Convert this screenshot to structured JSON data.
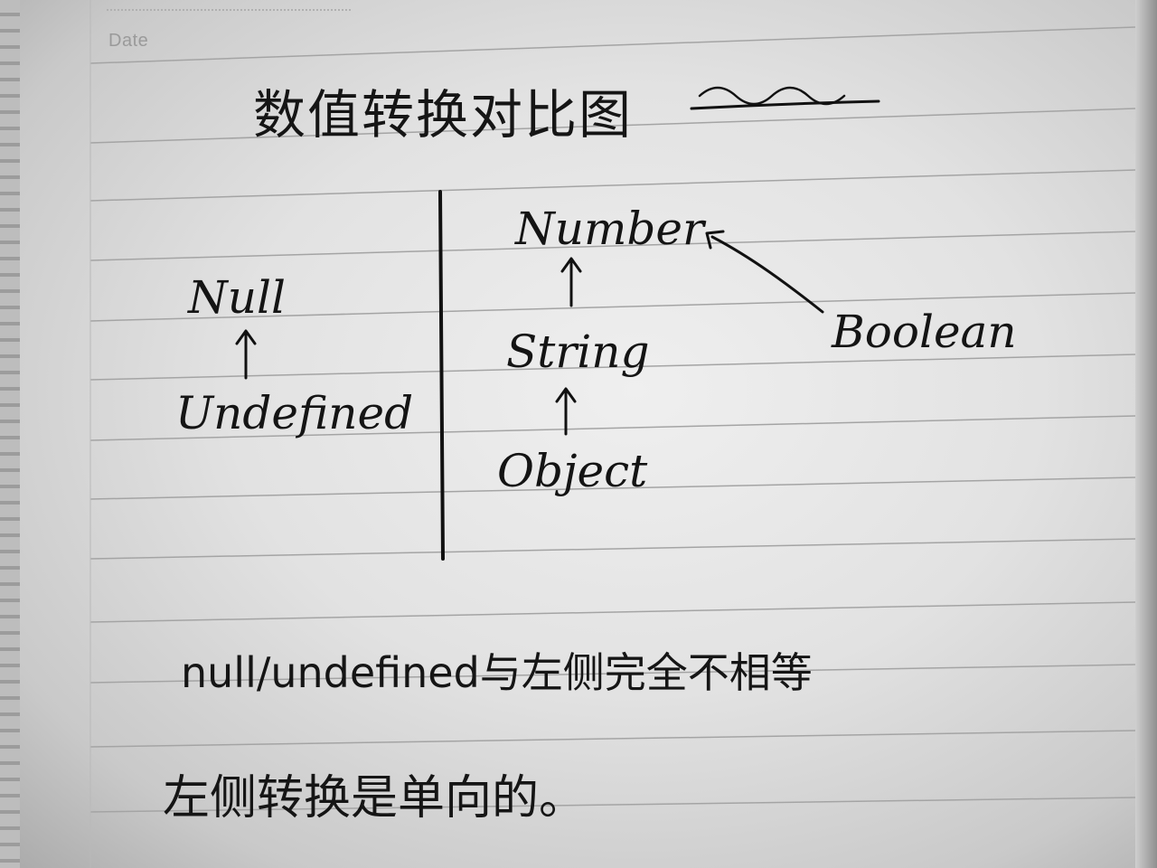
{
  "header": {
    "date_label": "Date"
  },
  "page_title": "数值转换对比图",
  "diagram": {
    "left_column": {
      "top": "Null",
      "bottom": "Undefined"
    },
    "right_column": {
      "top": "Number",
      "middle": "String",
      "bottom": "Object",
      "side": "Boolean"
    }
  },
  "notes": {
    "line1": "null/undefined与左侧完全不相等",
    "line2": "左侧转换是单向的。"
  }
}
